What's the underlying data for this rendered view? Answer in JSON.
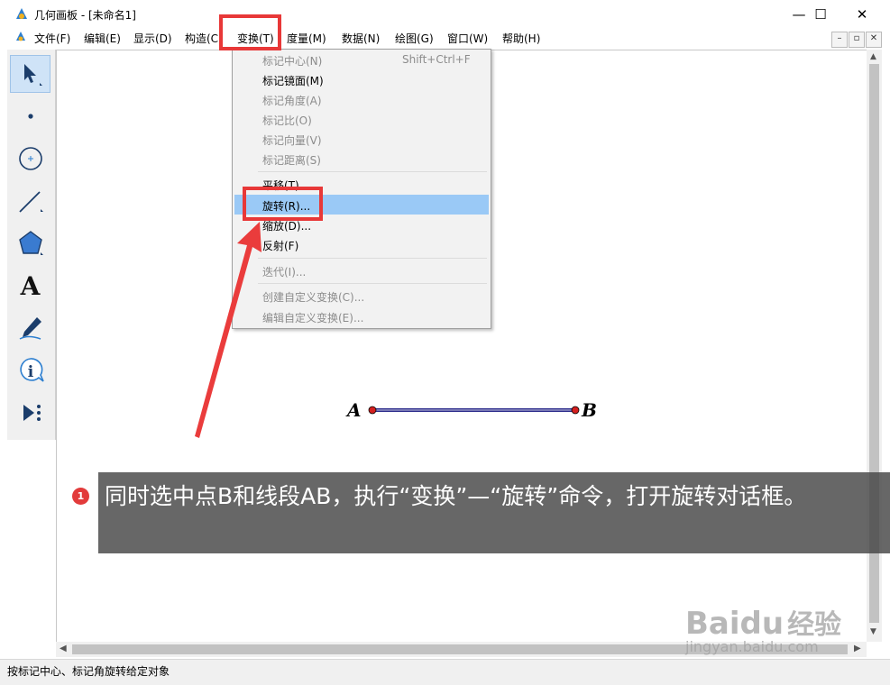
{
  "window": {
    "title": "几何画板 - [未命名1]",
    "minimize_glyph": "—",
    "maximize_glyph": "☐",
    "close_glyph": "✕"
  },
  "menubar": {
    "items": [
      {
        "label": "文件(F)"
      },
      {
        "label": "编辑(E)"
      },
      {
        "label": "显示(D)"
      },
      {
        "label": "构造(C"
      },
      {
        "label": "变换(T)"
      },
      {
        "label": "度量(M)"
      },
      {
        "label": "数据(N)"
      },
      {
        "label": "绘图(G)"
      },
      {
        "label": "窗口(W)"
      },
      {
        "label": "帮助(H)"
      }
    ],
    "mdi_minimize": "–",
    "mdi_restore": "▫",
    "mdi_close": "✕"
  },
  "transform_menu": {
    "items": [
      {
        "label": "标记中心(N)",
        "shortcut": "Shift+Ctrl+F",
        "enabled": false
      },
      {
        "label": "标记镜面(M)",
        "enabled": true
      },
      {
        "label": "标记角度(A)",
        "enabled": false
      },
      {
        "label": "标记比(O)",
        "enabled": false
      },
      {
        "label": "标记向量(V)",
        "enabled": false
      },
      {
        "label": "标记距离(S)",
        "enabled": false
      },
      {
        "label": "平移(T)...",
        "enabled": true
      },
      {
        "label": "旋转(R)...",
        "enabled": true,
        "highlighted": true
      },
      {
        "label": "缩放(D)...",
        "enabled": true
      },
      {
        "label": "反射(F)",
        "enabled": true
      },
      {
        "label": "迭代(I)...",
        "enabled": false
      },
      {
        "label": "创建自定义变换(C)...",
        "enabled": false
      },
      {
        "label": "编辑自定义变换(E)...",
        "enabled": false
      }
    ]
  },
  "toolbar": {
    "tools": [
      "arrow-select-tool",
      "point-tool",
      "compass-tool",
      "straightedge-tool",
      "polygon-tool",
      "text-tool",
      "marker-tool",
      "information-tool",
      "custom-tool"
    ],
    "text_tool_glyph": "A"
  },
  "canvas": {
    "point_a_label": "A",
    "point_b_label": "B",
    "segment_color": "#2a2a8a",
    "point_color": "#d42020"
  },
  "annotation": {
    "step_number": "1",
    "caption": "同时选中点B和线段AB，执行“变换”—“旋转”命令，打开旋转对话框。",
    "highlight_color": "#e83838"
  },
  "status": {
    "text": "按标记中心、标记角旋转给定对象"
  },
  "watermark": {
    "text1": "Baidu",
    "text2": "经验",
    "url": "jingyan.baidu.com"
  }
}
